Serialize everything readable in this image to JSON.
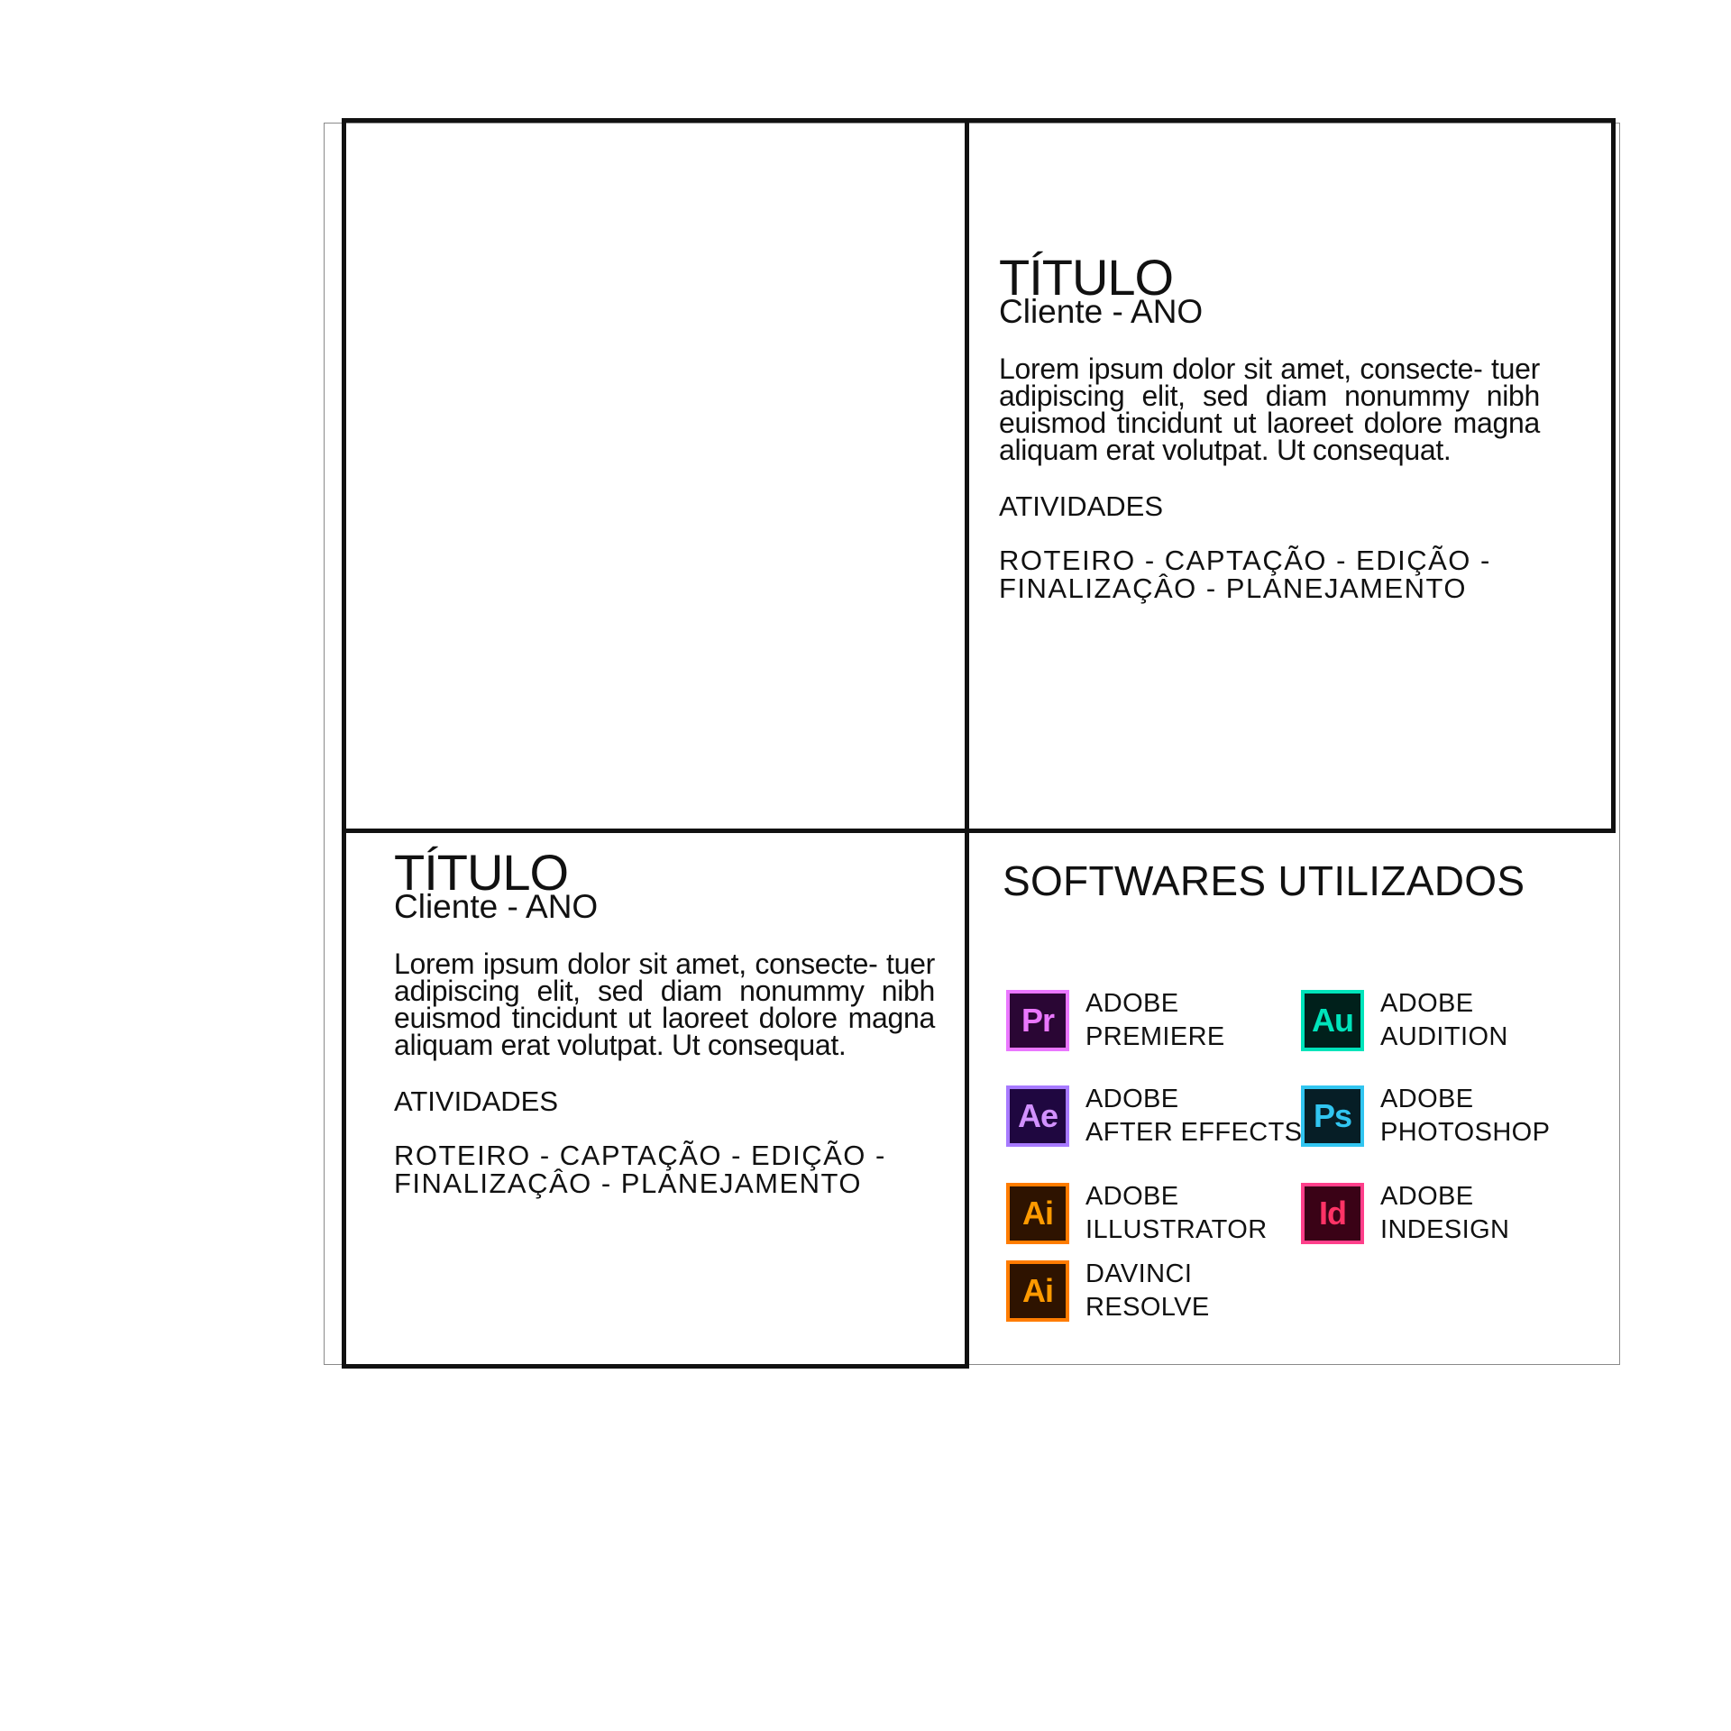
{
  "projects": {
    "top": {
      "title": "TÍTULO",
      "client": "Cliente - ANO",
      "description": "Lorem ipsum dolor sit amet, consecte- tuer adipiscing elit, sed diam nonummy nibh euismod tincidunt ut laoreet dolore magna aliquam erat volutpat. Ut consequat.",
      "activities_label": "ATIVIDADES",
      "activities_line1": "ROTEIRO - CAPTAÇÃO - EDIÇÃO -",
      "activities_line2": "FINALIZAÇÂO - PLANEJAMENTO"
    },
    "bottom": {
      "title": "TÍTULO",
      "client": "Cliente - ANO",
      "description": "Lorem ipsum dolor sit amet, consecte- tuer adipiscing elit, sed diam nonummy nibh euismod tincidunt ut laoreet dolore magna aliquam erat volutpat. Ut consequat.",
      "activities_label": "ATIVIDADES",
      "activities_line1": "ROTEIRO - CAPTAÇÃO - EDIÇÃO -",
      "activities_line2": "FINALIZAÇÂO - PLANEJAMENTO"
    }
  },
  "softwares": {
    "title": "SOFTWARES UTILIZADOS",
    "items": [
      {
        "icon": "premiere-icon",
        "abbr": "Pr",
        "line1": "ADOBE",
        "line2": "PREMIERE",
        "text_color": "#ea77ff",
        "bg_color": "#2a0634",
        "border_color": "#ea77ff"
      },
      {
        "icon": "audition-icon",
        "abbr": "Au",
        "line1": "ADOBE",
        "line2": "AUDITION",
        "text_color": "#00e4bb",
        "bg_color": "#00201b",
        "border_color": "#00e4bb"
      },
      {
        "icon": "after-effects-icon",
        "abbr": "Ae",
        "line1": "ADOBE",
        "line2": "AFTER EFFECTS",
        "text_color": "#d291ff",
        "bg_color": "#1f0740",
        "border_color": "#a77aff"
      },
      {
        "icon": "photoshop-icon",
        "abbr": "Ps",
        "line1": "ADOBE",
        "line2": "PHOTOSHOP",
        "text_color": "#31c5f0",
        "bg_color": "#061e26",
        "border_color": "#31c5f0"
      },
      {
        "icon": "illustrator-icon",
        "abbr": "Ai",
        "line1": "ADOBE",
        "line2": "ILLUSTRATOR",
        "text_color": "#ff9a00",
        "bg_color": "#2e1300",
        "border_color": "#ff7c00"
      },
      {
        "icon": "indesign-icon",
        "abbr": "Id",
        "line1": "ADOBE",
        "line2": "INDESIGN",
        "text_color": "#ff3366",
        "bg_color": "#3a0216",
        "border_color": "#ff3f8a"
      },
      {
        "icon": "davinci-resolve-icon",
        "abbr": "Ai",
        "line1": "DAVINCI",
        "line2": "RESOLVE",
        "text_color": "#ff9a00",
        "bg_color": "#2e1300",
        "border_color": "#ff7c00"
      }
    ]
  }
}
